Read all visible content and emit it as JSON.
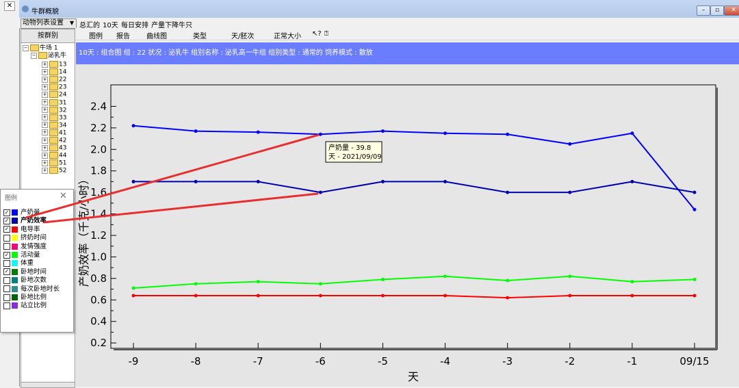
{
  "window": {
    "title": "牛群概貌",
    "close_label": "✕"
  },
  "menu": {
    "list_settings": "动物列表设置",
    "items": [
      "总汇的",
      "10天",
      "每日安排",
      "产量下降牛只"
    ]
  },
  "toolbar": {
    "items": [
      "图例",
      "报告",
      "曲线图",
      "类型",
      "天/胚次",
      "正常大小"
    ]
  },
  "left_panel": {
    "group_button": "按群别",
    "tree": {
      "root": "牛场 1",
      "group": "泌乳牛",
      "children": [
        "13",
        "14",
        "22",
        "23",
        "24",
        "31",
        "32",
        "33",
        "34",
        "41",
        "42",
        "43",
        "44",
        "51",
        "52"
      ]
    }
  },
  "info_bar": "10天 : 组合图   组 : 22  状况 : 泌乳牛   组别名称 : 泌乳高一牛组   组别类型 : 通常的   饲养模式 : 散放",
  "legend": {
    "title": "图例",
    "close": "✕",
    "items": [
      {
        "label": "产奶量",
        "checked": true,
        "color": "#0000ff"
      },
      {
        "label": "产奶效率",
        "checked": true,
        "color": "#0000aa",
        "bold": true
      },
      {
        "label": "电导率",
        "checked": true,
        "color": "#ff0000"
      },
      {
        "label": "挤奶时间",
        "checked": false,
        "color": "#ffff00"
      },
      {
        "label": "发情强度",
        "checked": false,
        "color": "#ff007f"
      },
      {
        "label": "活动量",
        "checked": true,
        "color": "#00ff00"
      },
      {
        "label": "体重",
        "checked": false,
        "color": "#00ffff"
      },
      {
        "label": "卧地时间",
        "checked": true,
        "color": "#008000"
      },
      {
        "label": "卧地次数",
        "checked": false,
        "color": "#008080"
      },
      {
        "label": "每次卧地时长",
        "checked": false,
        "color": "#2f8f8f"
      },
      {
        "label": "卧地比例",
        "checked": false,
        "color": "#006400"
      },
      {
        "label": "站立比例",
        "checked": false,
        "color": "#8a2be2"
      }
    ]
  },
  "chart_data": {
    "type": "line",
    "xlabel": "天",
    "ylabel": "产奶效率（千克/小时）",
    "categories": [
      "-9",
      "-8",
      "-7",
      "-6",
      "-5",
      "-4",
      "-3",
      "-2",
      "-1",
      "09/15"
    ],
    "ylim": [
      0.15,
      2.6
    ],
    "yticks": [
      0.2,
      0.4,
      0.6,
      0.8,
      1.0,
      1.2,
      1.4,
      1.6,
      1.8,
      2.0,
      2.2,
      2.4
    ],
    "grid": false,
    "series": [
      {
        "name": "产奶量",
        "color": "#0000ff",
        "values": [
          2.22,
          2.17,
          2.16,
          2.14,
          2.17,
          2.15,
          2.14,
          2.05,
          2.15,
          1.44
        ]
      },
      {
        "name": "产奶效率",
        "color": "#0000aa",
        "values": [
          1.7,
          1.7,
          1.7,
          1.6,
          1.7,
          1.7,
          1.6,
          1.6,
          1.7,
          1.6
        ]
      },
      {
        "name": "活动量",
        "color": "#00ff00",
        "values": [
          0.71,
          0.75,
          0.77,
          0.75,
          0.79,
          0.82,
          0.78,
          0.82,
          0.77,
          0.79
        ]
      },
      {
        "name": "电导率",
        "color": "#ff0000",
        "values": [
          0.64,
          0.64,
          0.64,
          0.64,
          0.64,
          0.64,
          0.62,
          0.64,
          0.64,
          0.64
        ]
      }
    ],
    "tooltip": {
      "line1": "产奶量 - 39.8",
      "line2": "天 - 2021/09/09"
    }
  }
}
